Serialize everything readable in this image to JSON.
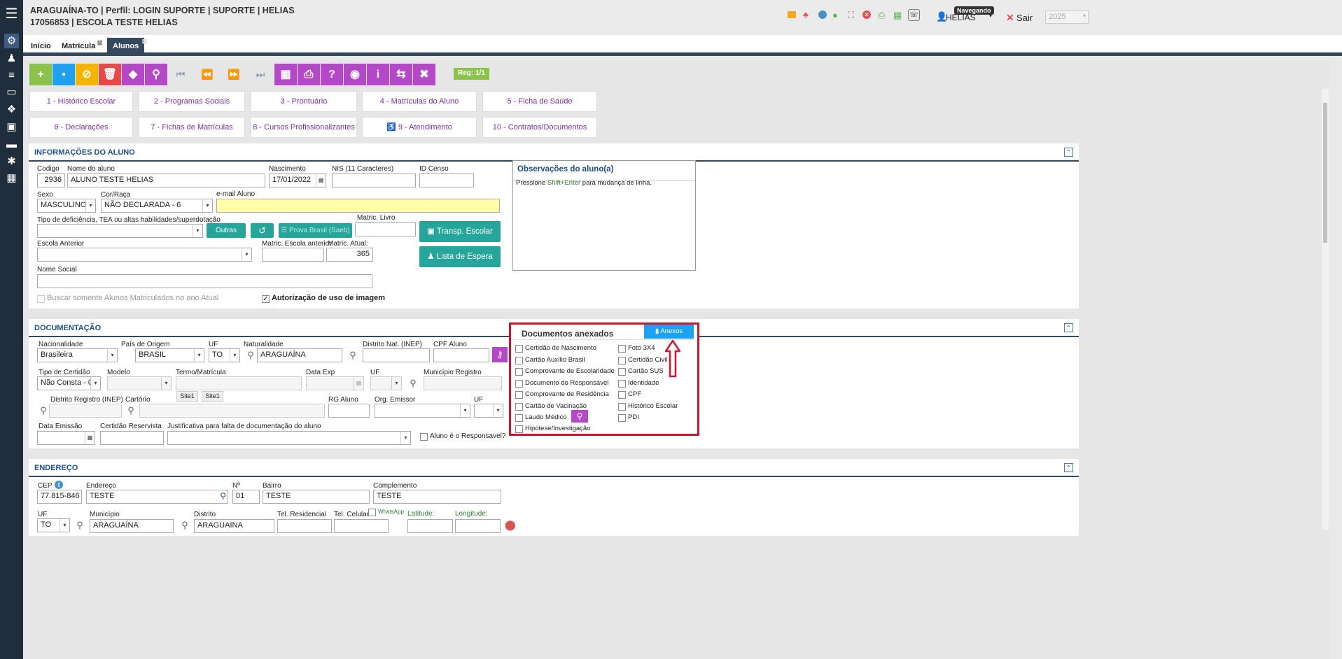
{
  "header": {
    "line1": "ARAGUAÍNA-TO | Perfil: LOGIN SUPORTE | SUPORTE | HELIAS",
    "line2": "17056853 | ESCOLA TESTE HELIAS",
    "user": "HELIAS",
    "badge": "Navegando",
    "logout": "Sair",
    "year": "2025"
  },
  "tabs": [
    {
      "label": "Início"
    },
    {
      "label": "Matrícula"
    },
    {
      "label": "Alunos"
    }
  ],
  "toolbar": {
    "reg": "Reg: 1/1"
  },
  "quick": [
    "1 - Histórico Escolar",
    "2 - Programas Sociais",
    "3 - Prontuário",
    "4 - Matrículas do Aluno",
    "5 - Ficha de Saúde",
    "6 - Declarações",
    "7 - Fichas de Matrículas",
    "8 - Cursos Profissionalizantes",
    "9 - Atendimento",
    "10 - Contratos/Documentos"
  ],
  "info": {
    "title": "INFORMAÇÕES DO ALUNO",
    "codigo_label": "Codigo",
    "codigo": "2936",
    "nome_label": "Nome do aluno",
    "nome": "ALUNO TESTE HELIAS",
    "nasc_label": "Nascimento",
    "nasc": "17/01/2022",
    "nis_label": "NIS (11 Caracteres)",
    "idcenso_label": "ID Censo",
    "sexo_label": "Sexo",
    "sexo": "MASCULINO",
    "cor_label": "Cor/Raça",
    "cor": "NÃO DECLARADA  - 6",
    "email_label": "e-mail Aluno",
    "def_label": "Tipo de deficiência, TEA ou altas habilidades/superdotação",
    "outras": "Outras",
    "prova": "Prova Brasil (Saeb)",
    "livro_label": "Matric. Livro",
    "transp": "Transp. Escolar",
    "escola_label": "Escola Anterior",
    "matesc_label": "Matric. Escola anterior",
    "matatual_label": "Matric. Atual:",
    "matatual": "365",
    "lista": "Lista de Espera",
    "social_label": "Nome Social",
    "buscar": "Buscar somente Alunos Matriculados no ano Atual",
    "autoriz": "Autorização de uso de imagem",
    "obs_title": "Observações do aluno(a)",
    "obs_hint1": "Pressione ",
    "obs_hint2": "Shift+Enter",
    "obs_hint3": " para mudança de linha."
  },
  "doc": {
    "title": "DOCUMENTAÇÃO",
    "nac_label": "Nacionalidade",
    "nac": "Brasileira",
    "pais_label": "País de Origem",
    "pais": "BRASIL",
    "uf_label": "UF",
    "uf": "TO",
    "nat_label": "Naturalidade",
    "nat": "ARAGUAÍNA",
    "distnat_label": "Distrito Nat. (INEP)",
    "cpf_label": "CPF Aluno",
    "certidao_label": "Tipo de Certidão",
    "certidao": "Não Consta - 0",
    "modelo_label": "Modelo",
    "termo_label": "Termo/Matrícula",
    "dataexp_label": "Data Exp",
    "uf2_label": "UF",
    "mun_label": "Município Registro",
    "distreg_label": "Distrito Registro (INEP)",
    "cartorio_label": "Cartório",
    "site1": "Site1",
    "site2": "Site1",
    "rg_label": "RG Aluno",
    "org_label": "Org. Emissor",
    "uf3_label": "UF",
    "dataem_label": "Data Emissão",
    "reserv_label": "Certidão Reservista",
    "just_label": "Justificativa para falta de documentação do aluno",
    "resp": "Aluno é o Responsavel?",
    "anexos_title": "Documentos anexados",
    "anexos_btn": "Anexos",
    "items_left": [
      "Certidão de Nascimento",
      "Cartão Auxílio Brasil",
      "Comprovante de Escolaridade",
      "Documento do Responsável",
      "Comprovante de Residência",
      "Cartão de Vacinação",
      "Laudo Médico",
      "Hipótese/Investigação"
    ],
    "items_right": [
      "Foto 3X4",
      "Certidão Civil",
      "Cartão SUS",
      "Identidade",
      "CPF",
      "Histórico Escolar",
      "PDI"
    ]
  },
  "end": {
    "title": "ENDEREÇO",
    "cep_label": "CEP",
    "cep": "77.815-846",
    "end_label": "Endereço",
    "end": "TESTE",
    "num_label": "Nº",
    "num": "01",
    "bairro_label": "Bairro",
    "bairro": "TESTE",
    "compl_label": "Complemento",
    "compl": "TESTE",
    "uf_label": "UF",
    "uf": "TO",
    "mun_label": "Município",
    "mun": "ARAGUAÍNA",
    "dist_label": "Distrito",
    "dist": "ARAGUAINA",
    "telres_label": "Tel. Residencial",
    "telcel_label": "Tel. Celular",
    "whats": "WhatsApp",
    "lat_label": "Latitude:",
    "lon_label": "Longitude:"
  },
  "colors": {
    "sidebar": "#1f2d3d",
    "accent": "#34495e",
    "highlight": "#d0142b"
  }
}
